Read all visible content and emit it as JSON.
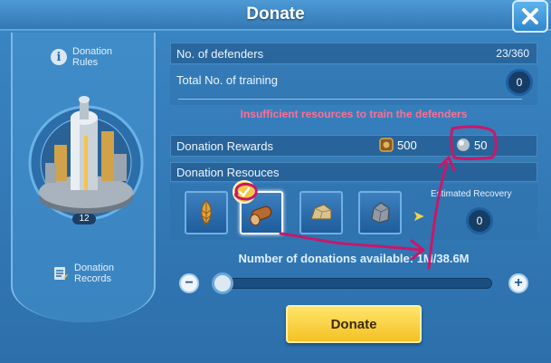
{
  "header": {
    "title": "Donate"
  },
  "left": {
    "rules_label": "Donation Rules",
    "rules_line1": "Donation",
    "rules_line2": "Rules",
    "building_level": "12",
    "records_line1": "Donation",
    "records_line2": "Records"
  },
  "stats": {
    "defenders_label": "No. of defenders",
    "defenders_value": "23/360",
    "training_label": "Total No. of training",
    "training_count": "0"
  },
  "warning": "Insufficient resources to train the defenders",
  "rewards": {
    "label": "Donation Rewards",
    "item1_value": "500",
    "item2_value": "50"
  },
  "resources": {
    "label": "Donation Resouces",
    "tiles": [
      {
        "name": "wheat",
        "selected": false
      },
      {
        "name": "wood",
        "selected": true
      },
      {
        "name": "stone",
        "selected": false
      },
      {
        "name": "iron",
        "selected": false
      }
    ],
    "estimated_label": "Estimated Recovery",
    "estimated_value": "0"
  },
  "donations": {
    "available_text": "Number of donations available: 1M/38.6M",
    "minus": "−",
    "plus": "+",
    "slider_fraction": 0
  },
  "donate_button": "Donate",
  "colors": {
    "annotation": "#c8186a",
    "warning": "#ff6f91",
    "button": "#f4c125"
  }
}
